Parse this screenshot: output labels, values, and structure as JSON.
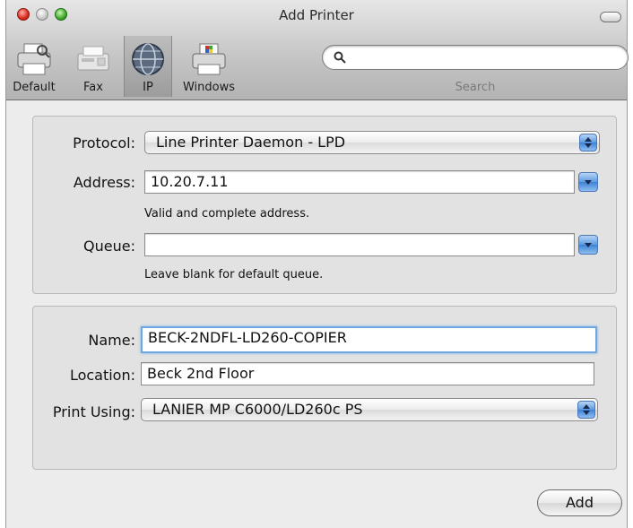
{
  "window": {
    "title": "Add Printer"
  },
  "toolbar": {
    "items": [
      {
        "label": "Default",
        "icon": "printer-default-icon"
      },
      {
        "label": "Fax",
        "icon": "fax-icon"
      },
      {
        "label": "IP",
        "icon": "ip-globe-icon",
        "selected": true
      },
      {
        "label": "Windows",
        "icon": "windows-printer-icon"
      }
    ],
    "search": {
      "label": "Search",
      "value": ""
    }
  },
  "connection": {
    "protocol_label": "Protocol:",
    "protocol_value": "Line Printer Daemon - LPD",
    "address_label": "Address:",
    "address_value": "10.20.7.11",
    "address_hint": "Valid and complete address.",
    "queue_label": "Queue:",
    "queue_value": "",
    "queue_hint": "Leave blank for default queue."
  },
  "details": {
    "name_label": "Name:",
    "name_value": "BECK-2NDFL-LD260-COPIER",
    "location_label": "Location:",
    "location_value": "Beck 2nd Floor",
    "print_using_label": "Print Using:",
    "print_using_value": "LANIER MP C6000/LD260c PS"
  },
  "actions": {
    "add_label": "Add"
  },
  "colors": {
    "accent": "#3c82d6",
    "focus_ring": "#6fa7e0"
  }
}
